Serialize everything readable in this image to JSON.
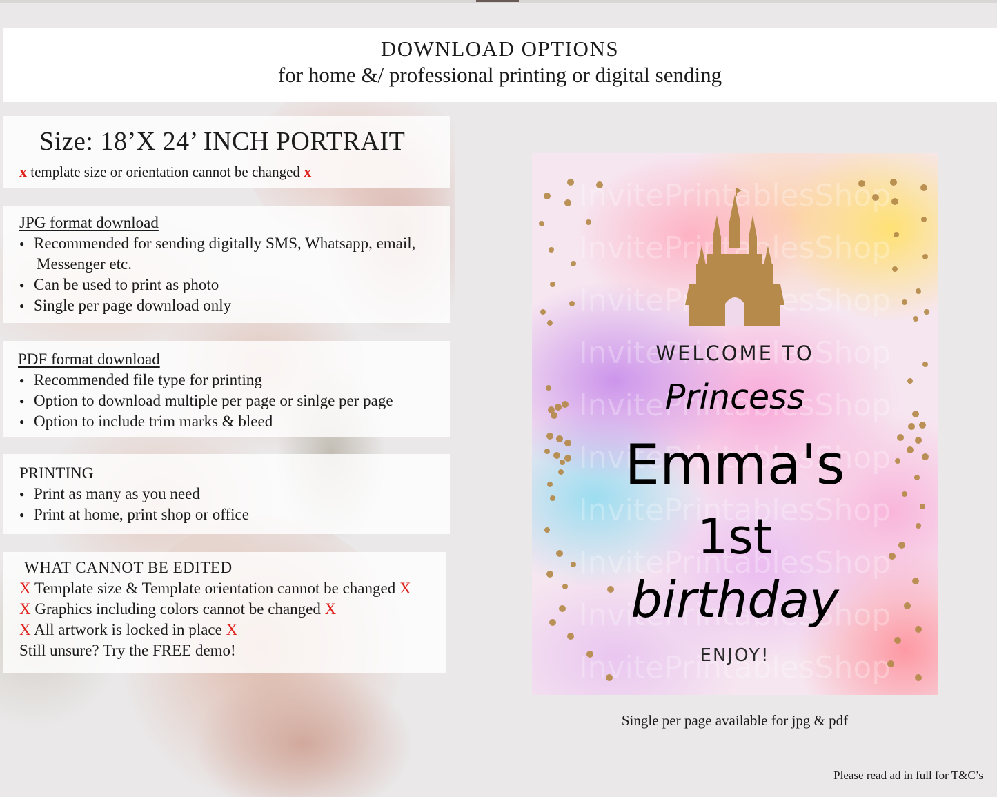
{
  "header": {
    "title": "DOWNLOAD OPTIONS",
    "subtitle": "for home &/ professional printing or digital sending"
  },
  "size_section": {
    "title": "Size: 18’X 24’ INCH PORTRAIT",
    "mark": "x",
    "note": " template size or orientation cannot be changed "
  },
  "jpg_section": {
    "title": "JPG format download",
    "items": [
      "Recommended for sending digitally SMS, Whatsapp, email,",
      "Can be used to print as photo",
      "Single per page download only"
    ],
    "item0_continuation": "Messenger etc."
  },
  "pdf_section": {
    "title": "PDF format download",
    "items": [
      "Recommended file type for printing",
      "Option to download multiple per page or sinlge per page",
      "Option to include trim marks & bleed"
    ]
  },
  "printing_section": {
    "title": "PRINTING",
    "items": [
      "Print as many as you need",
      "Print at home, print shop or office"
    ]
  },
  "edit_section": {
    "title": "WHAT CANNOT BE EDITED",
    "mark": "X",
    "lines": [
      " Template size & Template orientation cannot be changed ",
      " Graphics including colors cannot be changed ",
      " All artwork is locked in place "
    ],
    "closing": "Still unsure? Try the FREE demo!"
  },
  "poster": {
    "welcome": "WELCOME TO",
    "princess": "Princess",
    "name": "Emma's",
    "ordinal": "1st",
    "event": "birthday",
    "enjoy": "ENJOY!",
    "watermark": "InvitePrintablesShop",
    "colors": {
      "gold": "#b58a4a",
      "ink": "#000000"
    }
  },
  "caption": "Single per page available for jpg & pdf",
  "footer": "Please read ad in full for T&C’s",
  "colors": {
    "red_mark": "#e0201b",
    "panel_bg": "#ffffff",
    "page_bg": "#eae8e9"
  }
}
